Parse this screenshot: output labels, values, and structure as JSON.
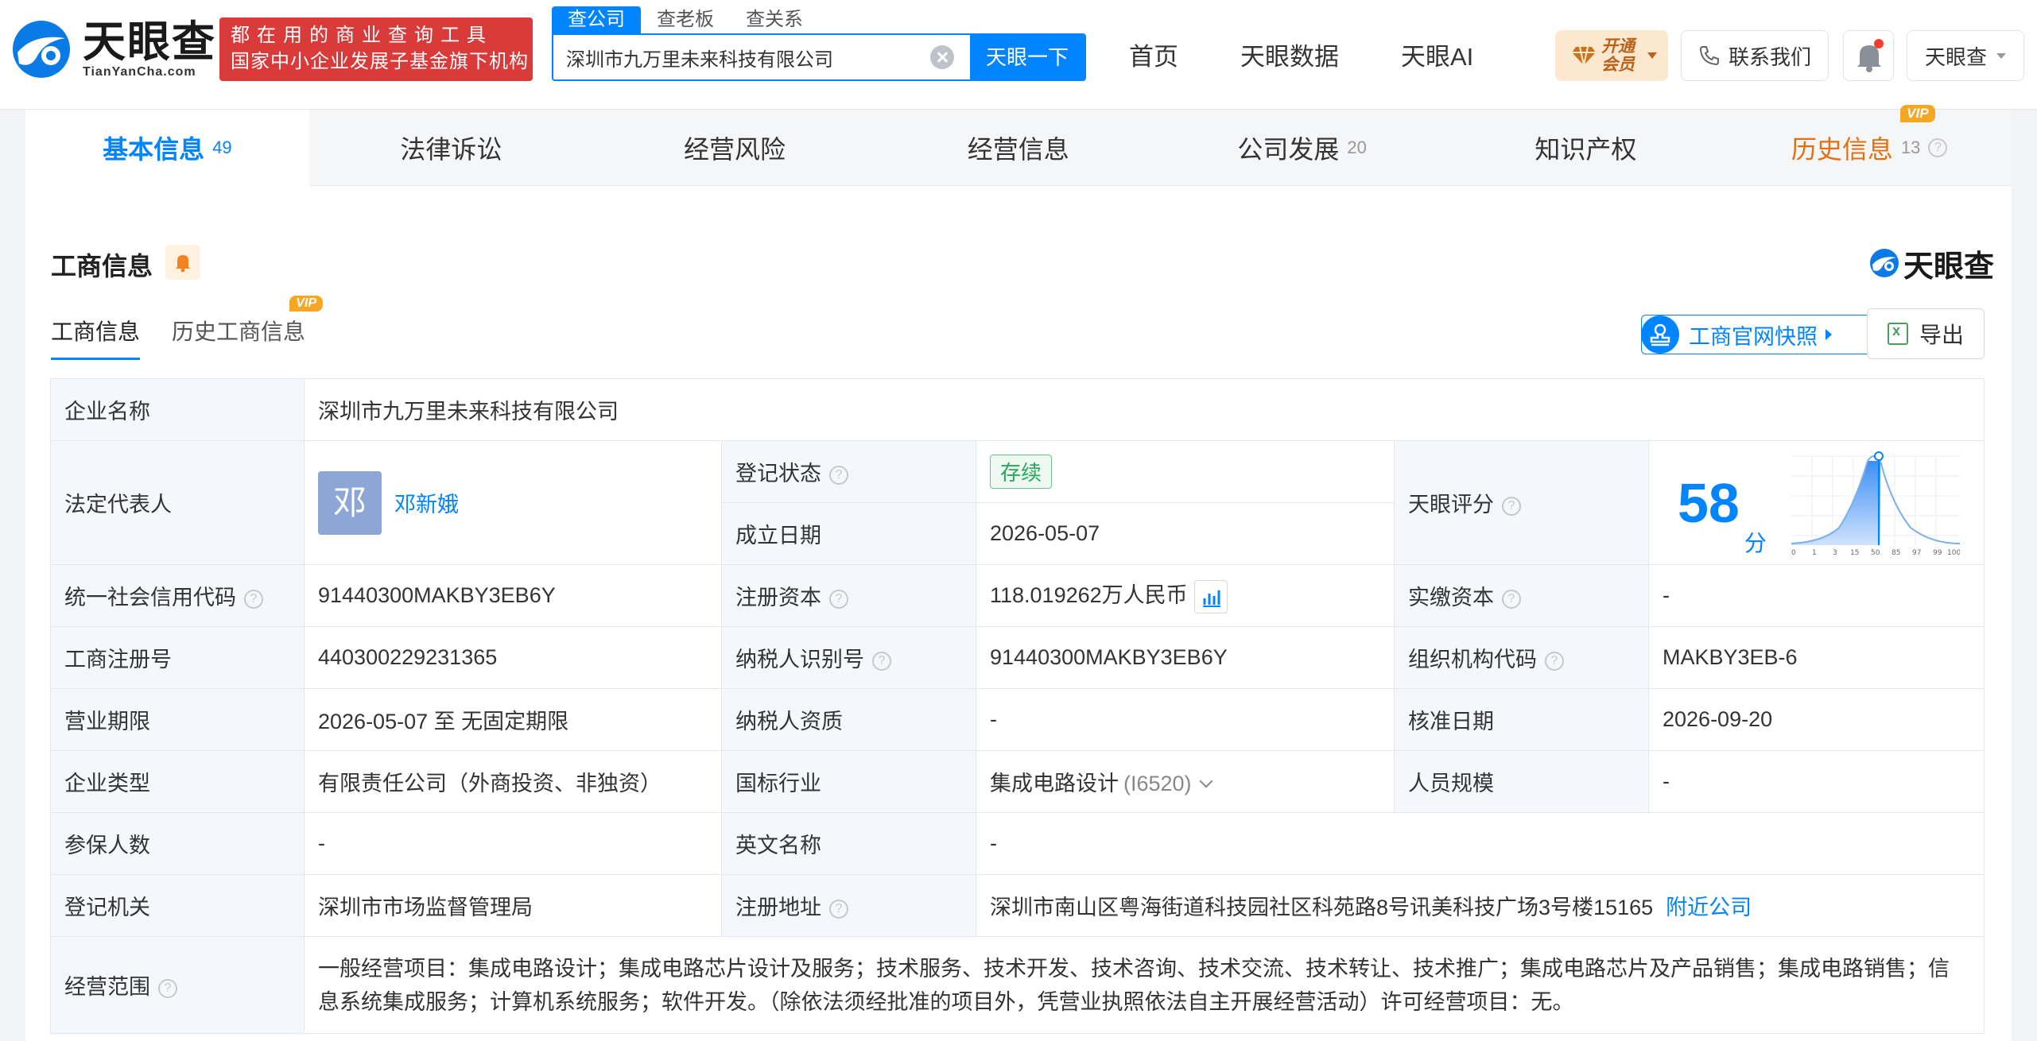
{
  "header": {
    "logo_cn": "天眼查",
    "logo_en": "TianYanCha.com",
    "slogan_line1": "都在用的商业查询工具",
    "slogan_line2": "国家中小企业发展子基金旗下机构",
    "search_tabs": [
      "查公司",
      "查老板",
      "查关系"
    ],
    "search_value": "深圳市九万里未来科技有限公司",
    "search_button": "天眼一下",
    "nav": [
      "首页",
      "天眼数据",
      "天眼AI"
    ],
    "vip_label": "开通会员",
    "contact_label": "联系我们",
    "user_label": "天眼查",
    "accent_color": "#0084ff"
  },
  "tabs": [
    {
      "label": "基本信息",
      "count": "49"
    },
    {
      "label": "法律诉讼",
      "count": ""
    },
    {
      "label": "经营风险",
      "count": ""
    },
    {
      "label": "经营信息",
      "count": ""
    },
    {
      "label": "公司发展",
      "count": "20"
    },
    {
      "label": "知识产权",
      "count": ""
    },
    {
      "label": "历史信息",
      "count": "13",
      "badge": "VIP"
    }
  ],
  "section": {
    "title": "工商信息",
    "brand": "天眼查",
    "subtabs": [
      "工商信息",
      "历史工商信息"
    ],
    "subtab_badge": "VIP",
    "snapshot_label": "工商官网快照",
    "export_label": "导出"
  },
  "info": {
    "company_name_label": "企业名称",
    "company_name": "深圳市九万里未来科技有限公司",
    "legal_rep_label": "法定代表人",
    "legal_rep_avatar": "邓",
    "legal_rep": "邓新娥",
    "status_label": "登记状态",
    "status": "存续",
    "founded_label": "成立日期",
    "founded": "2026-05-07",
    "score_label": "天眼评分",
    "score": "58",
    "score_unit": "分",
    "score_axis": [
      "0",
      "1",
      "3",
      "15",
      "50",
      "85",
      "97",
      "99",
      "100"
    ],
    "credit_code_label": "统一社会信用代码",
    "credit_code": "91440300MAKBY3EB6Y",
    "reg_capital_label": "注册资本",
    "reg_capital": "118.019262万人民币",
    "paid_capital_label": "实缴资本",
    "paid_capital": "-",
    "reg_no_label": "工商注册号",
    "reg_no": "440300229231365",
    "taxpayer_id_label": "纳税人识别号",
    "taxpayer_id": "91440300MAKBY3EB6Y",
    "org_code_label": "组织机构代码",
    "org_code": "MAKBY3EB-6",
    "term_label": "营业期限",
    "term": "2026-05-07 至 无固定期限",
    "taxpayer_qual_label": "纳税人资质",
    "taxpayer_qual": "-",
    "approval_date_label": "核准日期",
    "approval_date": "2026-09-20",
    "type_label": "企业类型",
    "type": "有限责任公司（外商投资、非独资）",
    "industry_label": "国标行业",
    "industry": "集成电路设计",
    "industry_code": "(I6520)",
    "staff_size_label": "人员规模",
    "staff_size": "-",
    "insured_label": "参保人数",
    "insured": "-",
    "en_name_label": "英文名称",
    "en_name": "-",
    "authority_label": "登记机关",
    "authority": "深圳市市场监督管理局",
    "address_label": "注册地址",
    "address": "深圳市南山区粤海街道科技园社区科苑路8号讯美科技广场3号楼15165",
    "nearby_link": "附近公司",
    "scope_label": "经营范围",
    "scope": "一般经营项目：集成电路设计；集成电路芯片设计及服务；技术服务、技术开发、技术咨询、技术交流、技术转让、技术推广；集成电路芯片及产品销售；集成电路销售；信息系统集成服务；计算机系统服务；软件开发。（除依法须经批准的项目外，凭营业执照依法自主开展经营活动）许可经营项目：无。"
  }
}
